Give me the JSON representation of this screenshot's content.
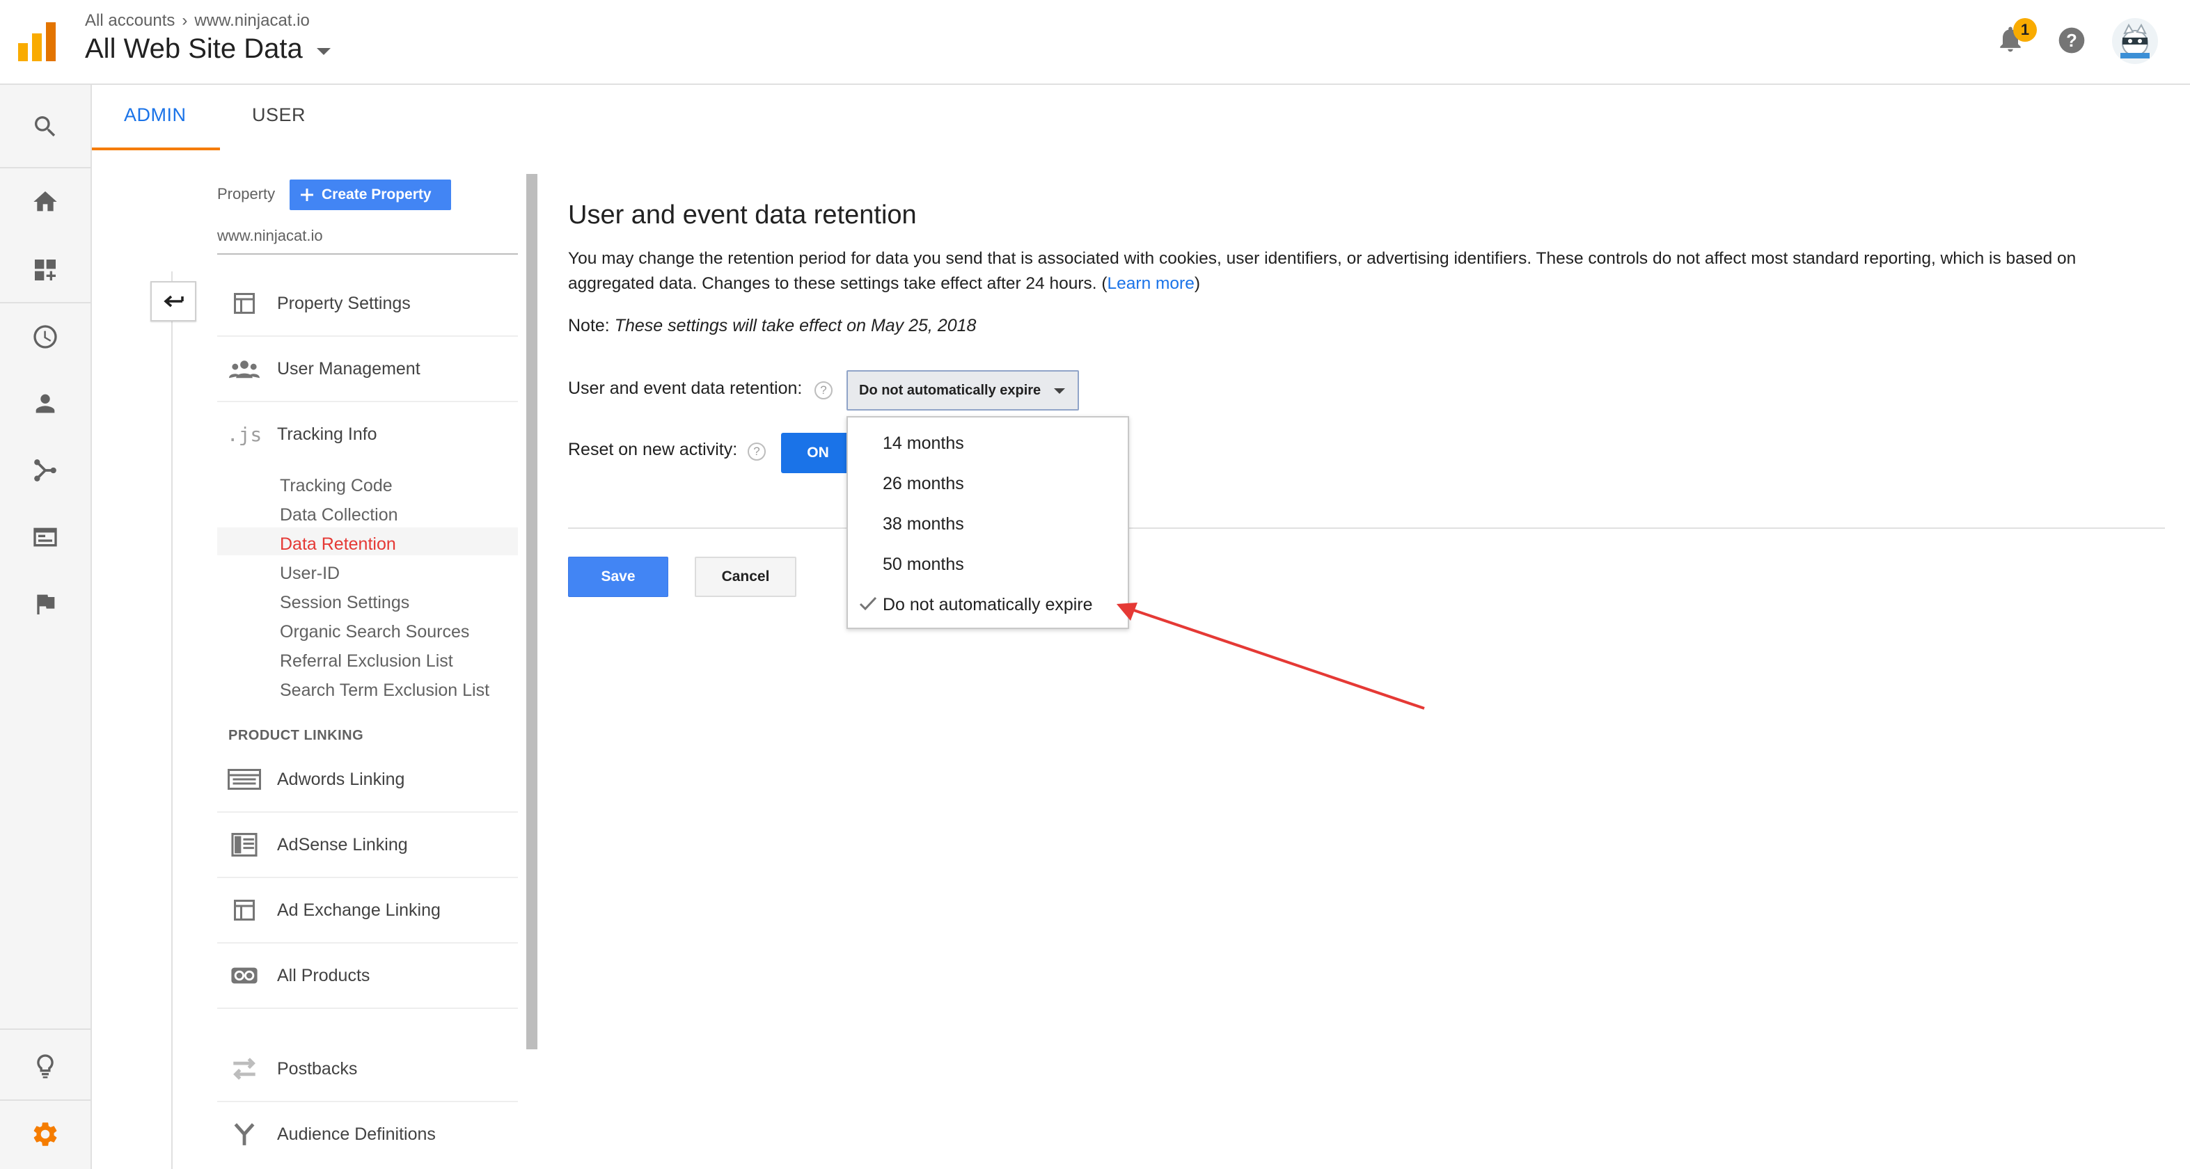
{
  "header": {
    "breadcrumb": [
      "All accounts",
      "www.ninjacat.io"
    ],
    "breadcrumb_sep": "›",
    "view_title": "All Web Site Data",
    "notification_count": "1",
    "icons": [
      "analytics-logo",
      "bell-icon",
      "help-icon",
      "avatar"
    ]
  },
  "rail": {
    "icons": [
      "search-icon",
      "home-icon",
      "customization-icon",
      "realtime-clock-icon",
      "audience-person-icon",
      "acquisition-icon",
      "behavior-icon",
      "conversions-flag-icon",
      "discover-bulb-icon",
      "admin-gear-icon"
    ]
  },
  "tabs": [
    {
      "label": "ADMIN",
      "active": true
    },
    {
      "label": "USER",
      "active": false
    }
  ],
  "property": {
    "label": "Property",
    "create_button": "Create Property",
    "name": "www.ninjacat.io",
    "nav": [
      {
        "label": "Property Settings",
        "icon": "property-settings-icon"
      },
      {
        "label": "User Management",
        "icon": "users-icon"
      },
      {
        "label": "Tracking Info",
        "icon": "js-icon",
        "icon_text": ".js"
      }
    ],
    "tracking_sub": [
      {
        "label": "Tracking Code"
      },
      {
        "label": "Data Collection"
      },
      {
        "label": "Data Retention",
        "active": true
      },
      {
        "label": "User-ID"
      },
      {
        "label": "Session Settings"
      },
      {
        "label": "Organic Search Sources"
      },
      {
        "label": "Referral Exclusion List"
      },
      {
        "label": "Search Term Exclusion List"
      }
    ],
    "linking_header": "PRODUCT LINKING",
    "linking": [
      {
        "label": "Adwords Linking",
        "icon": "adwords-icon"
      },
      {
        "label": "AdSense Linking",
        "icon": "adsense-icon"
      },
      {
        "label": "Ad Exchange Linking",
        "icon": "ad-exchange-icon"
      },
      {
        "label": "All Products",
        "icon": "all-products-icon"
      },
      {
        "label": "Postbacks",
        "icon": "postbacks-icon"
      },
      {
        "label": "Audience Definitions",
        "icon": "audience-definitions-icon"
      }
    ]
  },
  "main": {
    "title": "User and event data retention",
    "description": "You may change the retention period for data you send that is associated with cookies, user identifiers, or advertising identifiers. These controls do not affect most standard reporting, which is based on aggregated data. Changes to these settings take effect after 24 hours. (",
    "learn_more": "Learn more",
    "description_end": ")",
    "note_prefix": "Note: ",
    "note_text": "These settings will take effect on May 25, 2018",
    "retention_label": "User and event data retention:",
    "retention_value": "Do not automatically expire",
    "reset_label": "Reset on new activity:",
    "reset_toggle": "ON",
    "help_glyph": "?",
    "save": "Save",
    "cancel": "Cancel"
  },
  "dropdown": {
    "options": [
      {
        "label": "14 months",
        "selected": false
      },
      {
        "label": "26 months",
        "selected": false
      },
      {
        "label": "38 months",
        "selected": false
      },
      {
        "label": "50 months",
        "selected": false
      },
      {
        "label": "Do not automatically expire",
        "selected": true
      }
    ]
  },
  "colors": {
    "accent_blue": "#1a73e8",
    "button_blue": "#4285f4",
    "tab_underline": "#f57c00",
    "active_nav": "#e53935",
    "badge": "#f9ab00",
    "admin_gear": "#f57c00",
    "annotation_arrow": "#e53935"
  }
}
